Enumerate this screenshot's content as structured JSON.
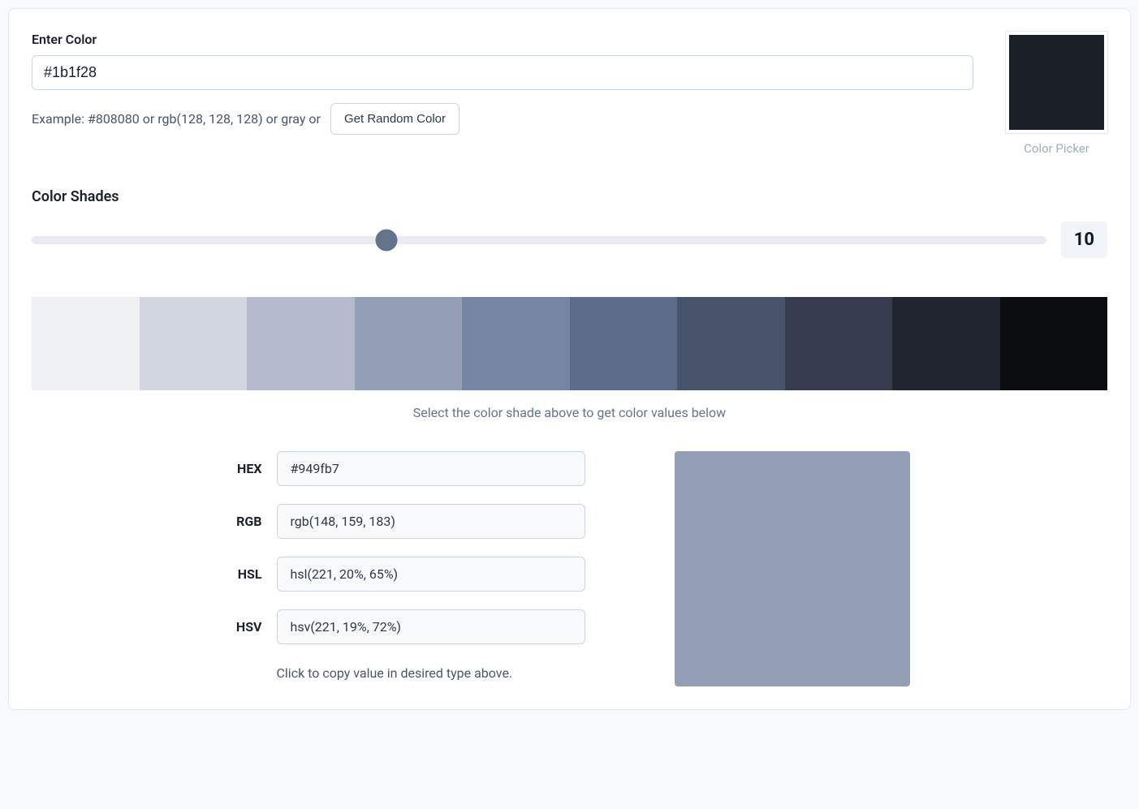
{
  "enter_color": {
    "label": "Enter Color",
    "value": "#1b1f28",
    "example_text": "Example: #808080 or rgb(128, 128, 128) or gray or",
    "random_button": "Get Random Color"
  },
  "picker": {
    "color": "#1b1f28",
    "label": "Color Picker"
  },
  "shades": {
    "title": "Color Shades",
    "slider_value": "10",
    "slider_percent": 35,
    "colors": [
      "#eef0f4",
      "#d1d6e1",
      "#b3bbcc",
      "#949fb7",
      "#7685a3",
      "#5d6c8a",
      "#48546b",
      "#343c4d",
      "#1f242e",
      "#0b0c10"
    ],
    "hint": "Select the color shade above to get color values below"
  },
  "values": {
    "hex": {
      "label": "HEX",
      "value": "#949fb7"
    },
    "rgb": {
      "label": "RGB",
      "value": "rgb(148, 159, 183)"
    },
    "hsl": {
      "label": "HSL",
      "value": "hsl(221, 20%, 65%)"
    },
    "hsv": {
      "label": "HSV",
      "value": "hsv(221, 19%, 72%)"
    },
    "preview_color": "#949fb7",
    "copy_hint": "Click to copy value in desired type above."
  }
}
